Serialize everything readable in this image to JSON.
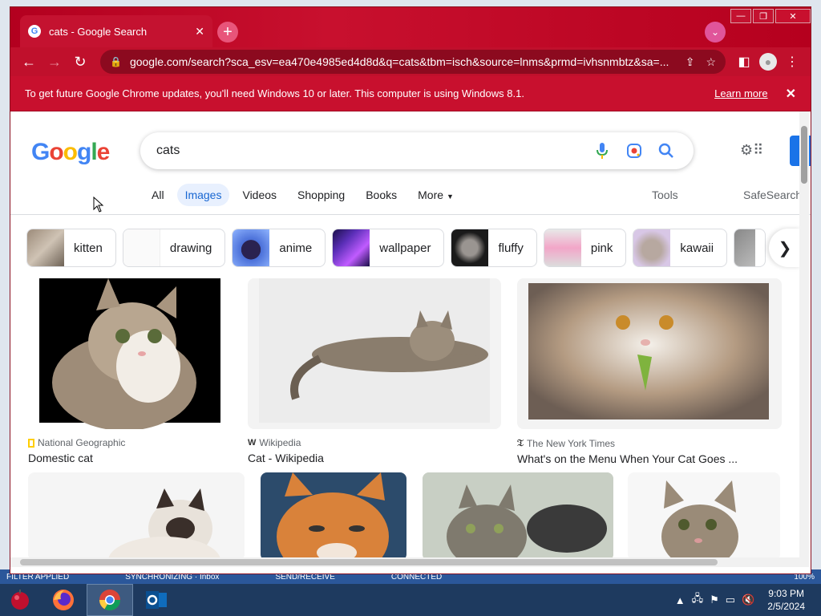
{
  "background_status": {
    "items": [
      "FILTER APPLIED",
      "SYNCHRONIZING · Inbox",
      "SEND/RECEIVE",
      "CONNECTED",
      "100%"
    ]
  },
  "browser": {
    "tab_title": "cats - Google Search",
    "url": "google.com/search?sca_esv=ea470e4985ed4d8d&q=cats&tbm=isch&source=lnms&prmd=ivhsnmbtz&sa=...",
    "infobar": {
      "message": "To get future Google Chrome updates, you'll need Windows 10 or later. This computer is using Windows 8.1.",
      "learn_more": "Learn more"
    },
    "accent_color": "#c8102e"
  },
  "google": {
    "search_query": "cats",
    "nav_tabs": [
      "All",
      "Images",
      "Videos",
      "Shopping",
      "Books",
      "More"
    ],
    "active_tab": "Images",
    "tools": "Tools",
    "safesearch": "SafeSearch",
    "chips": [
      "kitten",
      "drawing",
      "anime",
      "wallpaper",
      "fluffy",
      "pink",
      "kawaii"
    ],
    "results": [
      {
        "source": "National Geographic",
        "title": "Domestic cat"
      },
      {
        "source": "Wikipedia",
        "title": "Cat - Wikipedia"
      },
      {
        "source": "The New York Times",
        "title": "What's on the Menu When Your Cat Goes ..."
      }
    ]
  },
  "taskbar": {
    "time": "9:03 PM",
    "date": "2/5/2024"
  }
}
